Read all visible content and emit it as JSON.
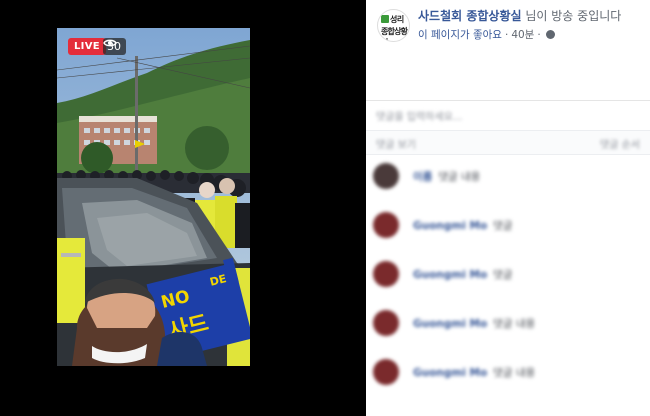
{
  "video": {
    "live_label": "LIVE",
    "viewer_count": "30",
    "sign_text_1": "NO",
    "sign_text_2": "사드",
    "sign_text_3": "DE"
  },
  "page": {
    "avatar_line1": "성리",
    "avatar_line2": "종합상황실",
    "name": "사드철회 종합상황실",
    "status": " 님이 방송 중입니다",
    "like_label": "이 페이지가 좋아요",
    "time": "40분"
  },
  "comment_input": {
    "placeholder": "댓글을 입력하세요..."
  },
  "comments_header": {
    "left": "댓글 보기",
    "right": "댓글 순서"
  },
  "comments": [
    {
      "author": "이름",
      "text": "댓글 내용"
    },
    {
      "author": "Guongmi Mo",
      "text": "댓글"
    },
    {
      "author": "Guongmi Mo",
      "text": "댓글"
    },
    {
      "author": "Guongmi Mo",
      "text": "댓글 내용"
    },
    {
      "author": "Guongmi Mo",
      "text": "댓글 내용"
    }
  ],
  "colors": {
    "live_red": "#e42d3b",
    "facebook_blue": "#385898",
    "meta_gray": "#606770"
  }
}
